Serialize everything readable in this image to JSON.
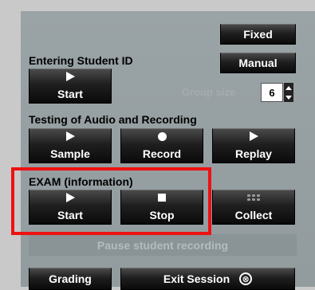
{
  "header": {
    "fixed_label": "Fixed",
    "manual_label": "Manual"
  },
  "student_id": {
    "title": "Entering Student ID",
    "start_label": "Start"
  },
  "group_size": {
    "label": "Group size",
    "value": "6"
  },
  "testing": {
    "title": "Testing of Audio and Recording",
    "sample_label": "Sample",
    "record_label": "Record",
    "replay_label": "Replay"
  },
  "exam": {
    "title": "EXAM  (information)",
    "start_label": "Start",
    "stop_label": "Stop",
    "collect_label": "Collect"
  },
  "pause_label": "Pause student recording",
  "footer": {
    "grading_label": "Grading",
    "exit_label": "Exit Session",
    "exit_icon": "⊗"
  },
  "colors": {
    "highlight": "#ee1111",
    "panel": "#9aa3a6",
    "button": "#111111"
  }
}
